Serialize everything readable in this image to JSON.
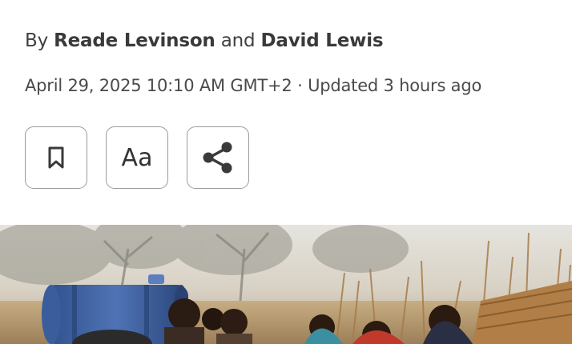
{
  "byline": {
    "prefix": "By",
    "author1": "Reade Levinson",
    "conjunction": "and",
    "author2": "David Lewis"
  },
  "dateline": {
    "date": "April 29, 2025 10:10 AM GMT+2",
    "separator": "·",
    "updated": "Updated 3 hours ago"
  },
  "actions": {
    "bookmark_icon": "bookmark-icon",
    "text_size_label": "Aa",
    "share_icon": "share-icon"
  },
  "colors": {
    "text": "#404040",
    "button_border": "#9a9a9a"
  }
}
